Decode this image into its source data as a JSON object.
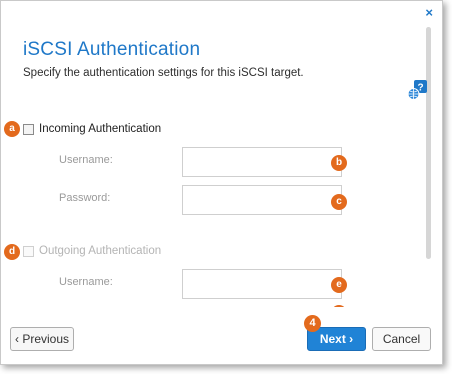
{
  "dialog": {
    "close_glyph": "×",
    "title": "iSCSI Authentication",
    "subtitle": "Specify the authentication settings for this iSCSI target.",
    "help_icon": "help-globe-icon"
  },
  "markers": {
    "a": "a",
    "b": "b",
    "c": "c",
    "d": "d",
    "e": "e",
    "f": "f",
    "n4": "4"
  },
  "incoming": {
    "label": "Incoming Authentication",
    "username_label": "Username:",
    "password_label": "Password:",
    "username_value": "",
    "password_value": ""
  },
  "outgoing": {
    "label": "Outgoing Authentication",
    "username_label": "Username:",
    "username_value": ""
  },
  "footer": {
    "previous_label": "‹ Previous",
    "next_label": "Next ›",
    "cancel_label": "Cancel"
  },
  "colors": {
    "accent": "#1f78c8",
    "marker": "#e36a1d"
  }
}
